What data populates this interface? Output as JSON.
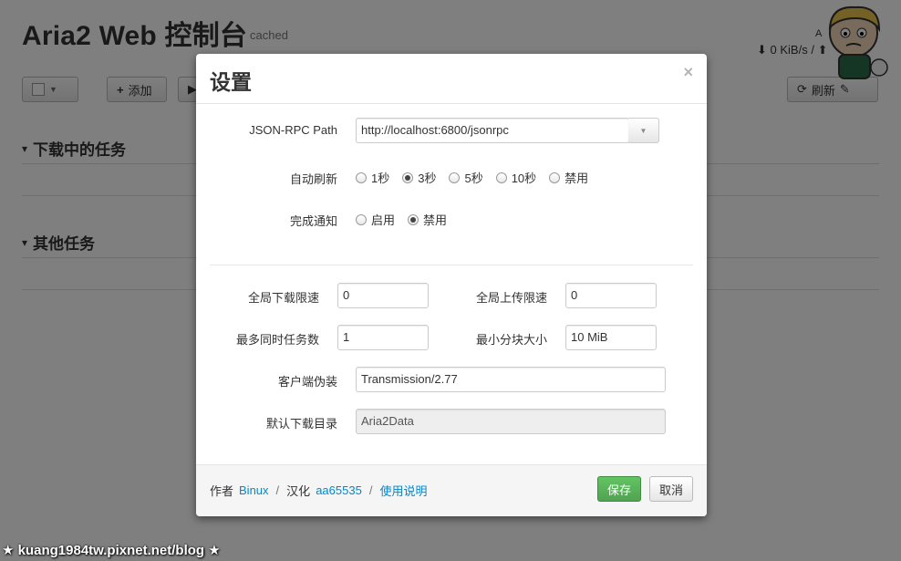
{
  "app": {
    "title": "Aria2 Web 控制台",
    "subtitle": "cached",
    "brand_text": "A",
    "speed_status": "0 KiB/s / ",
    "toolbar": {
      "add_label": "添加",
      "refresh_label": "刷新"
    },
    "sections": {
      "downloading": "下载中的任务",
      "other": "其他任务"
    }
  },
  "modal": {
    "title": "设置",
    "close_symbol": "×",
    "rpc": {
      "label": "JSON-RPC Path",
      "value": "http://localhost:6800/jsonrpc"
    },
    "auto_refresh": {
      "label": "自动刷新",
      "options": [
        "1秒",
        "3秒",
        "5秒",
        "10秒",
        "禁用"
      ],
      "selected": "3秒"
    },
    "notify": {
      "label": "完成通知",
      "options": [
        "启用",
        "禁用"
      ],
      "selected": "禁用"
    },
    "global_download_limit": {
      "label": "全局下载限速",
      "value": "0"
    },
    "global_upload_limit": {
      "label": "全局上传限速",
      "value": "0"
    },
    "max_concurrent": {
      "label": "最多同时任务数",
      "value": "1"
    },
    "min_split_size": {
      "label": "最小分块大小",
      "value": "10 MiB"
    },
    "user_agent": {
      "label": "客户端伪装",
      "value": "Transmission/2.77"
    },
    "default_dir": {
      "label": "默认下载目录",
      "value": "Aria2Data"
    },
    "footer": {
      "author_label": "作者",
      "author_link": "Binux",
      "translator_label": "汉化",
      "translator_link": "aa65535",
      "help_link": "使用说明",
      "separator": "/"
    },
    "save_label": "保存",
    "cancel_label": "取消"
  },
  "watermark": "★ kuang1984tw.pixnet.net/blog ★",
  "colors": {
    "backdrop": "#000000",
    "link": "#0088cc",
    "save_button": "#5bb75b"
  }
}
